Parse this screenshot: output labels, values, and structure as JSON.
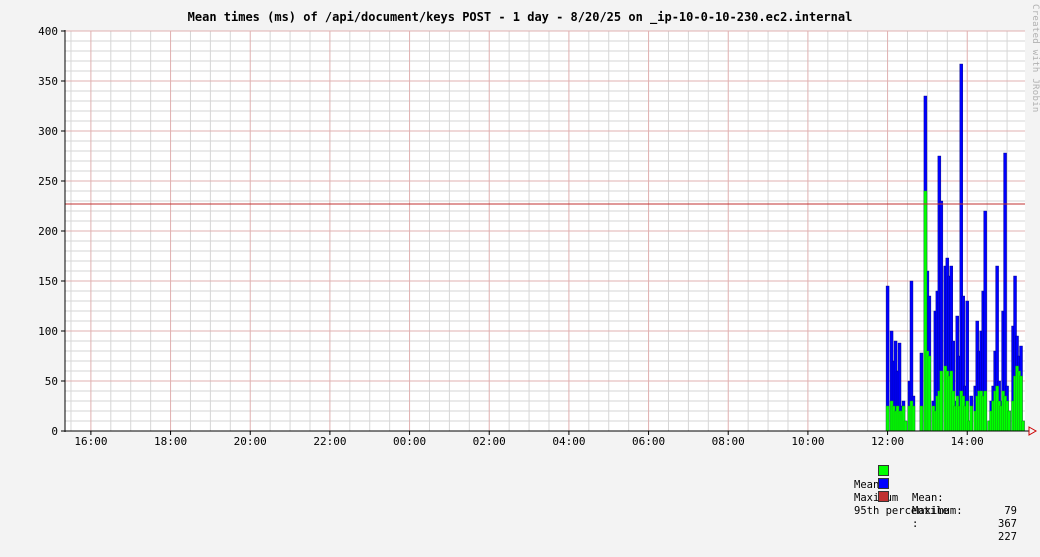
{
  "title": "Mean times (ms) of /api/document/keys POST - 1 day - 8/20/25 on _ip-10-0-10-230.ec2.internal",
  "watermark": "Created with JRobin",
  "colors": {
    "background": "#f3f3f3",
    "plot_background": "#ffffff",
    "minor_grid": "#d6d6d6",
    "major_grid": "#e0b0b0",
    "mean": "#00ff00",
    "maximum": "#0000ff",
    "percentile": "#c03030",
    "axis": "#000000",
    "arrow": "#cc0000"
  },
  "legend": [
    {
      "label": "Mean",
      "stat": "Mean:",
      "value": "79",
      "color": "#00ff00"
    },
    {
      "label": "Maximum",
      "stat": "Maximum:",
      "value": "367",
      "color": "#0000ff"
    },
    {
      "label": "95th percentile",
      "stat": ":",
      "value": "227",
      "color": "#c03030"
    }
  ],
  "chart_data": {
    "type": "area",
    "x_tick_labels": [
      "16:00",
      "18:00",
      "20:00",
      "22:00",
      "00:00",
      "02:00",
      "04:00",
      "06:00",
      "08:00",
      "10:00",
      "12:00",
      "14:00"
    ],
    "x_tick_hours": [
      16,
      18,
      20,
      22,
      24,
      26,
      28,
      30,
      32,
      34,
      36,
      38
    ],
    "xlim_hours": [
      15.35,
      39.45
    ],
    "ylim": [
      0,
      400
    ],
    "y_ticks": [
      0,
      50,
      100,
      150,
      200,
      250,
      300,
      350,
      400
    ],
    "grid": true,
    "legend_position": "bottom-right",
    "percentile_95": 227,
    "series": [
      {
        "name": "Maximum",
        "x_hours": [
          36.0,
          36.1,
          36.15,
          36.2,
          36.25,
          36.3,
          36.35,
          36.4,
          36.45,
          36.55,
          36.6,
          36.65,
          36.75,
          36.85,
          36.95,
          37.0,
          37.05,
          37.1,
          37.15,
          37.2,
          37.25,
          37.3,
          37.35,
          37.45,
          37.5,
          37.55,
          37.6,
          37.65,
          37.7,
          37.75,
          37.8,
          37.85,
          37.9,
          37.95,
          38.0,
          38.05,
          38.1,
          38.15,
          38.2,
          38.25,
          38.3,
          38.35,
          38.4,
          38.45,
          38.55,
          38.6,
          38.65,
          38.7,
          38.75,
          38.8,
          38.85,
          38.9,
          38.95,
          39.0,
          39.05,
          39.1,
          39.15,
          39.2,
          39.25,
          39.3,
          39.35,
          39.4
        ],
        "values": [
          145,
          100,
          70,
          90,
          60,
          88,
          25,
          30,
          10,
          50,
          150,
          35,
          0,
          78,
          335,
          160,
          135,
          0,
          30,
          120,
          140,
          275,
          230,
          165,
          173,
          155,
          165,
          90,
          30,
          115,
          75,
          367,
          135,
          45,
          130,
          10,
          35,
          0,
          45,
          110,
          80,
          100,
          140,
          220,
          10,
          30,
          45,
          80,
          165,
          50,
          30,
          120,
          278,
          45,
          20,
          0,
          105,
          155,
          95,
          75,
          85,
          10
        ],
        "color": "#0000ff"
      },
      {
        "name": "Mean",
        "x_hours": [
          36.0,
          36.1,
          36.15,
          36.2,
          36.25,
          36.3,
          36.35,
          36.4,
          36.45,
          36.55,
          36.6,
          36.65,
          36.75,
          36.85,
          36.95,
          37.0,
          37.05,
          37.1,
          37.15,
          37.2,
          37.25,
          37.3,
          37.35,
          37.45,
          37.5,
          37.55,
          37.6,
          37.65,
          37.7,
          37.75,
          37.8,
          37.85,
          37.9,
          37.95,
          38.0,
          38.05,
          38.1,
          38.15,
          38.2,
          38.25,
          38.3,
          38.35,
          38.4,
          38.45,
          38.55,
          38.6,
          38.65,
          38.7,
          38.75,
          38.8,
          38.85,
          38.9,
          38.95,
          39.0,
          39.05,
          39.1,
          39.15,
          39.2,
          39.25,
          39.3,
          39.35,
          39.4
        ],
        "values": [
          25,
          30,
          25,
          20,
          25,
          20,
          20,
          25,
          10,
          25,
          30,
          25,
          0,
          25,
          240,
          80,
          75,
          0,
          25,
          20,
          35,
          40,
          60,
          65,
          60,
          55,
          60,
          40,
          25,
          35,
          25,
          40,
          35,
          25,
          30,
          10,
          25,
          0,
          20,
          35,
          40,
          40,
          35,
          40,
          10,
          20,
          30,
          40,
          45,
          30,
          25,
          40,
          35,
          30,
          20,
          0,
          30,
          55,
          65,
          60,
          55,
          10
        ],
        "color": "#00ff00"
      }
    ]
  }
}
